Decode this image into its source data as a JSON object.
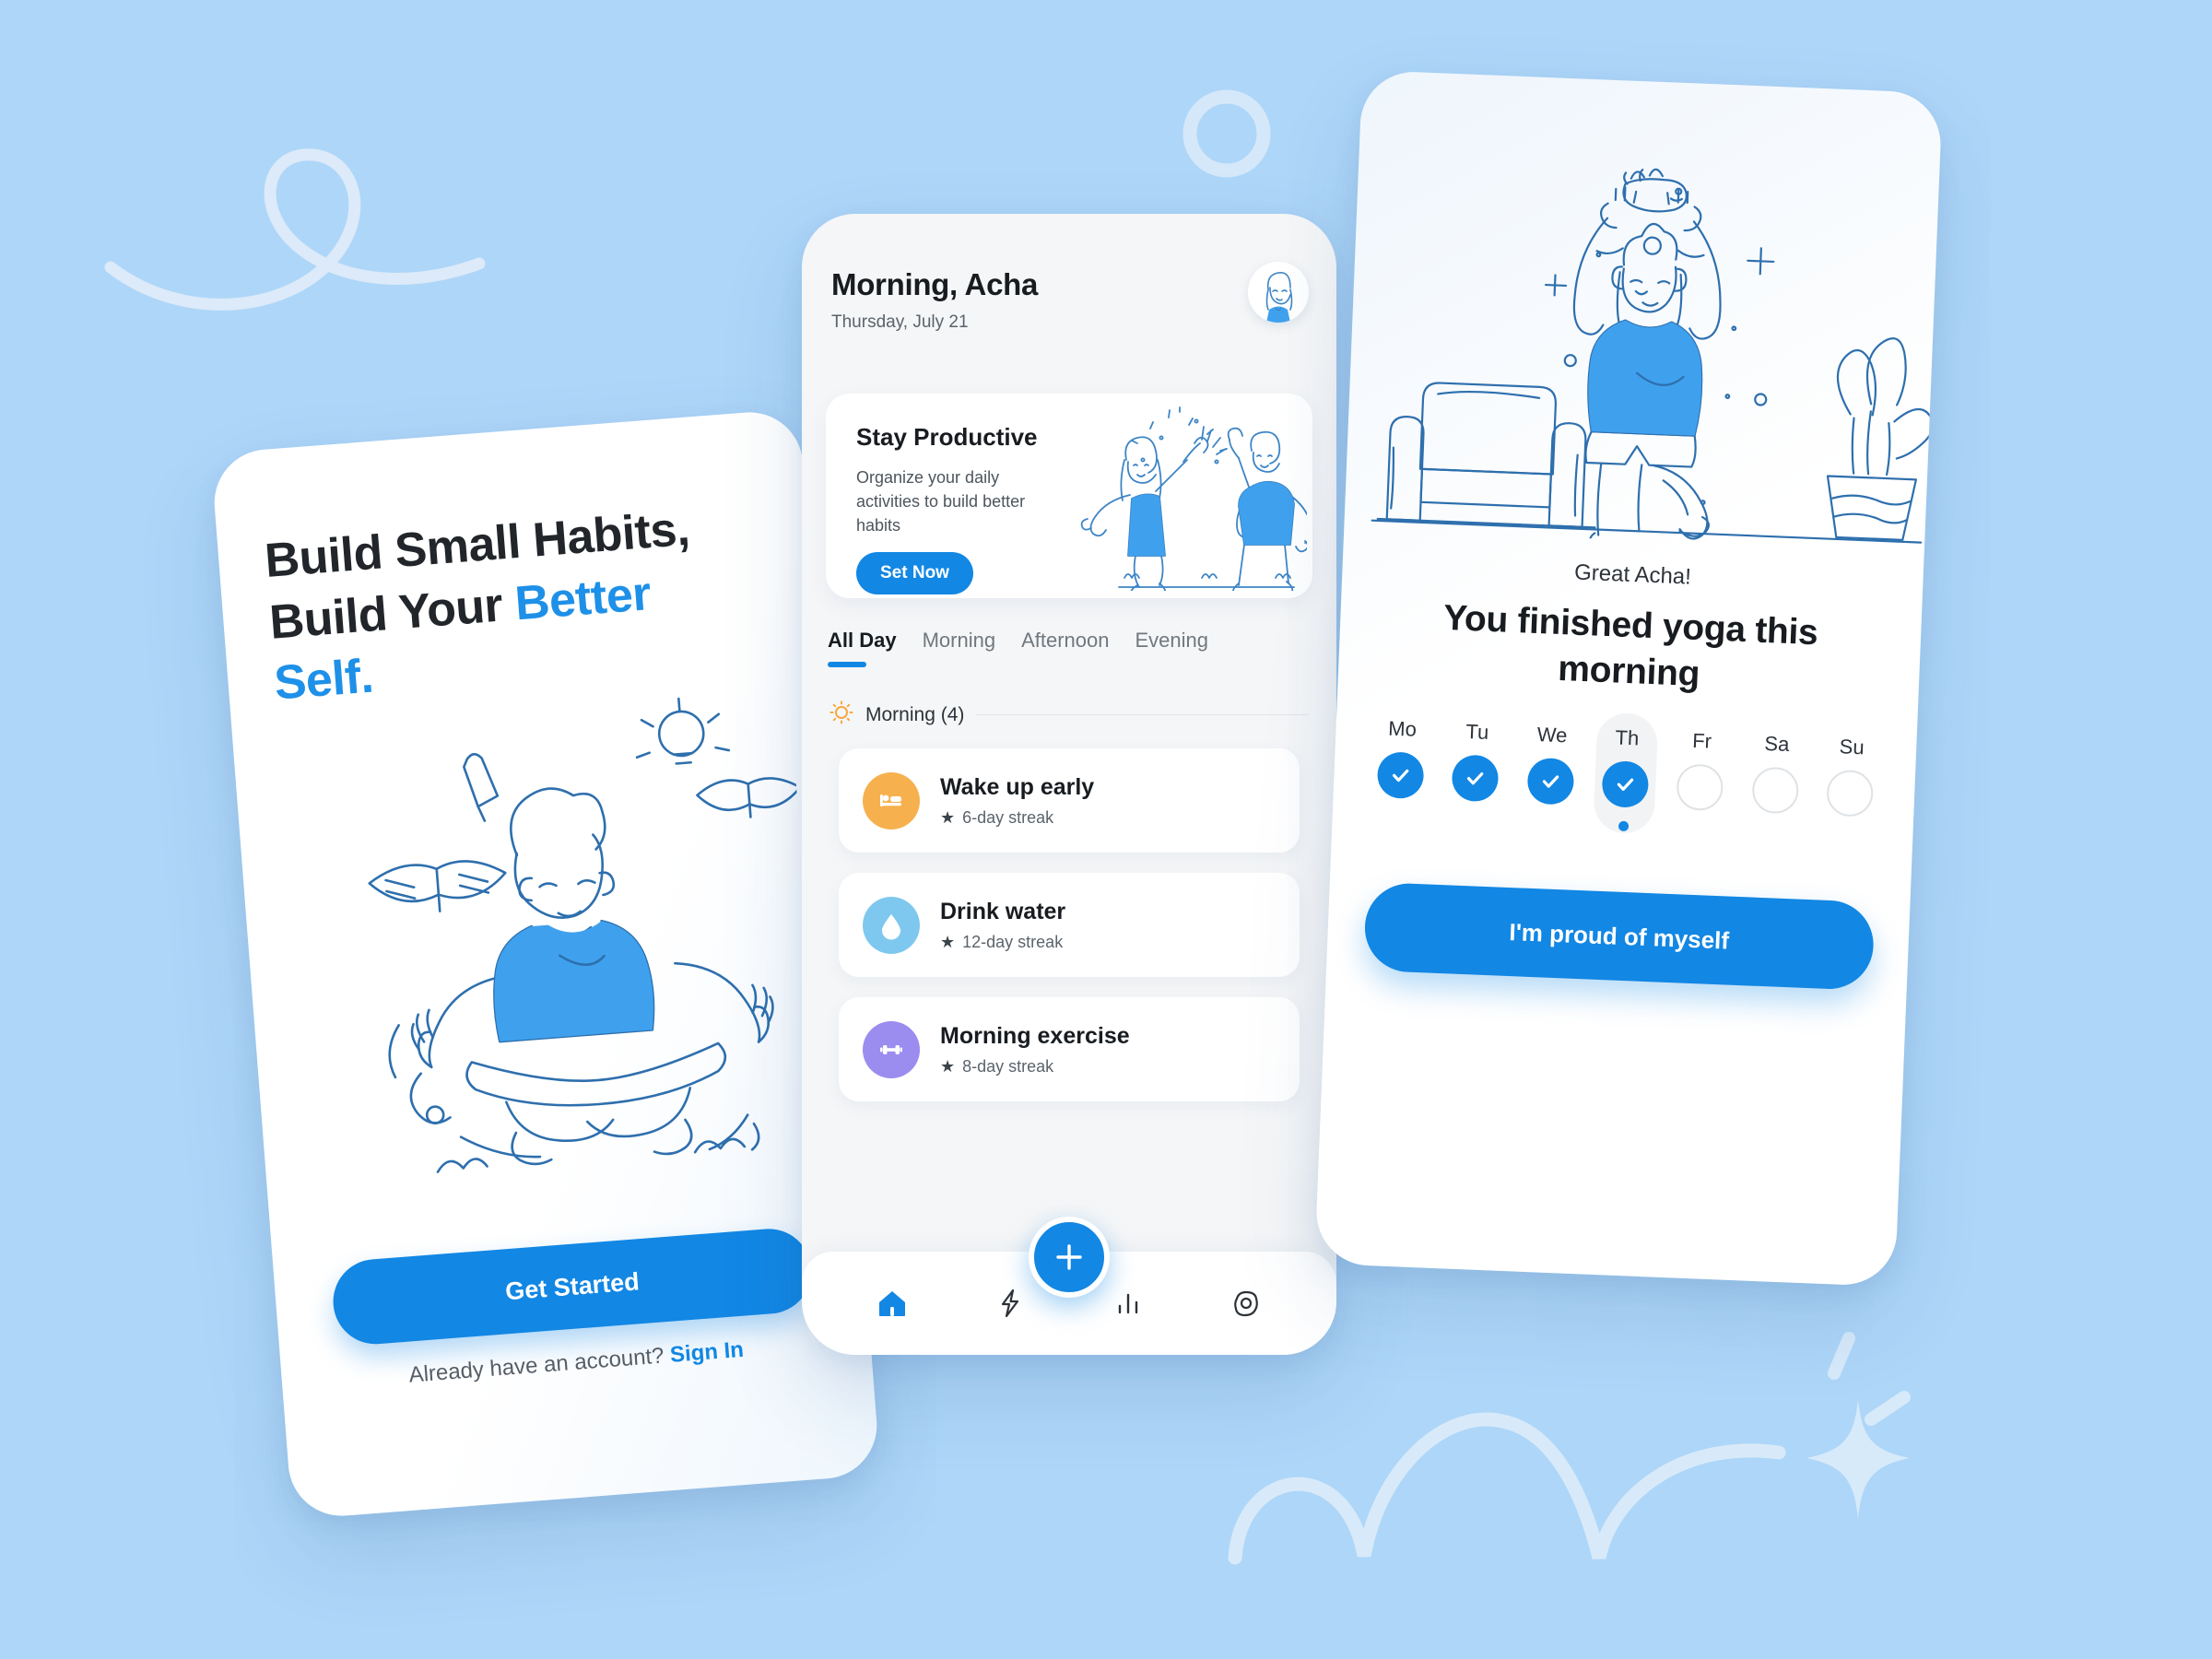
{
  "theme": {
    "background": "#aed6f8",
    "accent": "#1287e4",
    "accent_light": "#4aa8ef",
    "text_dark": "#181c20",
    "text_muted": "#5b636b",
    "card_bg": "#ffffff",
    "screen_bg": "#f5f6f7"
  },
  "onboarding": {
    "headline_part1": "Build Small Habits,",
    "headline_part2": "Build Your ",
    "headline_accent1": "Better",
    "headline_accent2": "Self.",
    "illustration_name": "man-meditating-with-books-and-ideas",
    "cta_label": "Get Started",
    "footer_text": "Already have an account? ",
    "footer_link": "Sign In"
  },
  "home": {
    "greeting": "Morning, Acha",
    "date": "Thursday, July 21",
    "avatar_name": "user-avatar-acha",
    "promo": {
      "title": "Stay Productive",
      "description": "Organize your daily activities to build better habits",
      "button_label": "Set Now",
      "illustration_name": "two-people-high-five"
    },
    "tabs": [
      {
        "label": "All Day",
        "active": true
      },
      {
        "label": "Morning",
        "active": false
      },
      {
        "label": "Afternoon",
        "active": false
      },
      {
        "label": "Evening",
        "active": false
      }
    ],
    "section": {
      "icon": "sun-icon",
      "icon_color": "#f7a83c",
      "label": "Morning (4)"
    },
    "habits": [
      {
        "title": "Wake up early",
        "streak": "6-day streak",
        "icon": "bed-icon",
        "color": "#f6b14e"
      },
      {
        "title": "Drink water",
        "streak": "12-day streak",
        "icon": "water-drop-icon",
        "color": "#7ec8ef"
      },
      {
        "title": "Morning exercise",
        "streak": "8-day streak",
        "icon": "dumbbell-icon",
        "color": "#9b8cf0"
      }
    ],
    "nav": [
      {
        "name": "home-icon",
        "active": true
      },
      {
        "name": "lightning-bolt-icon",
        "active": false
      },
      {
        "name": "bar-chart-icon",
        "active": false
      },
      {
        "name": "camera-icon",
        "active": false
      }
    ],
    "fab_label": "+"
  },
  "celebration": {
    "illustration_name": "woman-yoga-tree-pose-with-cat",
    "subtitle": "Great Acha!",
    "title": "You finished yoga this morning",
    "days": [
      {
        "label": "Mo",
        "done": true,
        "selected": false
      },
      {
        "label": "Tu",
        "done": true,
        "selected": false
      },
      {
        "label": "We",
        "done": true,
        "selected": false
      },
      {
        "label": "Th",
        "done": true,
        "selected": true
      },
      {
        "label": "Fr",
        "done": false,
        "selected": false
      },
      {
        "label": "Sa",
        "done": false,
        "selected": false
      },
      {
        "label": "Su",
        "done": false,
        "selected": false
      }
    ],
    "cta_label": "I'm proud of myself"
  },
  "decorations": [
    {
      "name": "loop-squiggle-top-left"
    },
    {
      "name": "circle-outline-top"
    },
    {
      "name": "bouncing-arc-bottom"
    },
    {
      "name": "sparkle-bottom-right"
    }
  ]
}
